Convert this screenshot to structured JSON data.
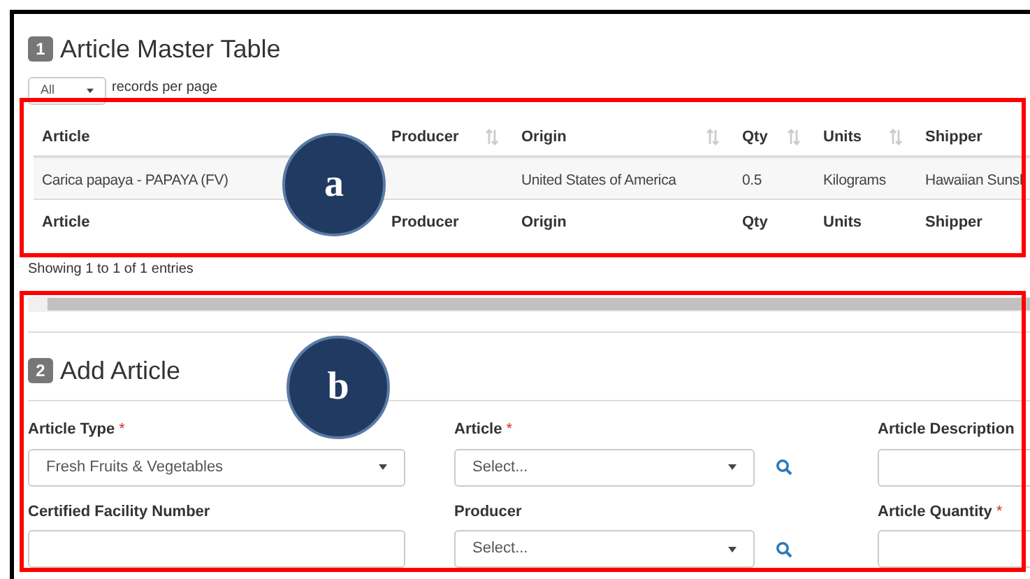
{
  "master_table": {
    "badge": "1",
    "title": "Article Master Table",
    "page_size": {
      "value": "All",
      "label": "records per page"
    },
    "columns": [
      {
        "header": "Article",
        "sortable": false
      },
      {
        "header": "Producer",
        "sortable": true
      },
      {
        "header": "Origin",
        "sortable": true
      },
      {
        "header": "Qty",
        "sortable": true
      },
      {
        "header": "Units",
        "sortable": true
      },
      {
        "header": "Shipper",
        "sortable": false
      }
    ],
    "rows": [
      [
        "Carica papaya - PAPAYA (FV)",
        "",
        "United States of America",
        "0.5",
        "Kilograms",
        "Hawaiian Sunsl"
      ]
    ],
    "footer": [
      "Article",
      "Producer",
      "Origin",
      "Qty",
      "Units",
      "Shipper"
    ],
    "info": "Showing 1 to 1 of 1 entries"
  },
  "add_article": {
    "badge": "2",
    "title": "Add Article",
    "fields": [
      {
        "label": "Article Type",
        "required_mark": "*",
        "kind": "select",
        "value": "Fresh Fruits & Vegetables",
        "search": false
      },
      {
        "label": "Article",
        "required_mark": "*",
        "kind": "select",
        "placeholder": "Select...",
        "search": true
      },
      {
        "label": "Article Description",
        "kind": "text"
      },
      {
        "label": "Certified Facility Number",
        "kind": "text"
      },
      {
        "label": "Producer",
        "kind": "select",
        "placeholder": "Select...",
        "search": true
      },
      {
        "label": "Article Quantity",
        "required_mark": "*",
        "kind": "text"
      }
    ]
  },
  "callouts": [
    {
      "letter": "a"
    },
    {
      "letter": "b"
    }
  ]
}
